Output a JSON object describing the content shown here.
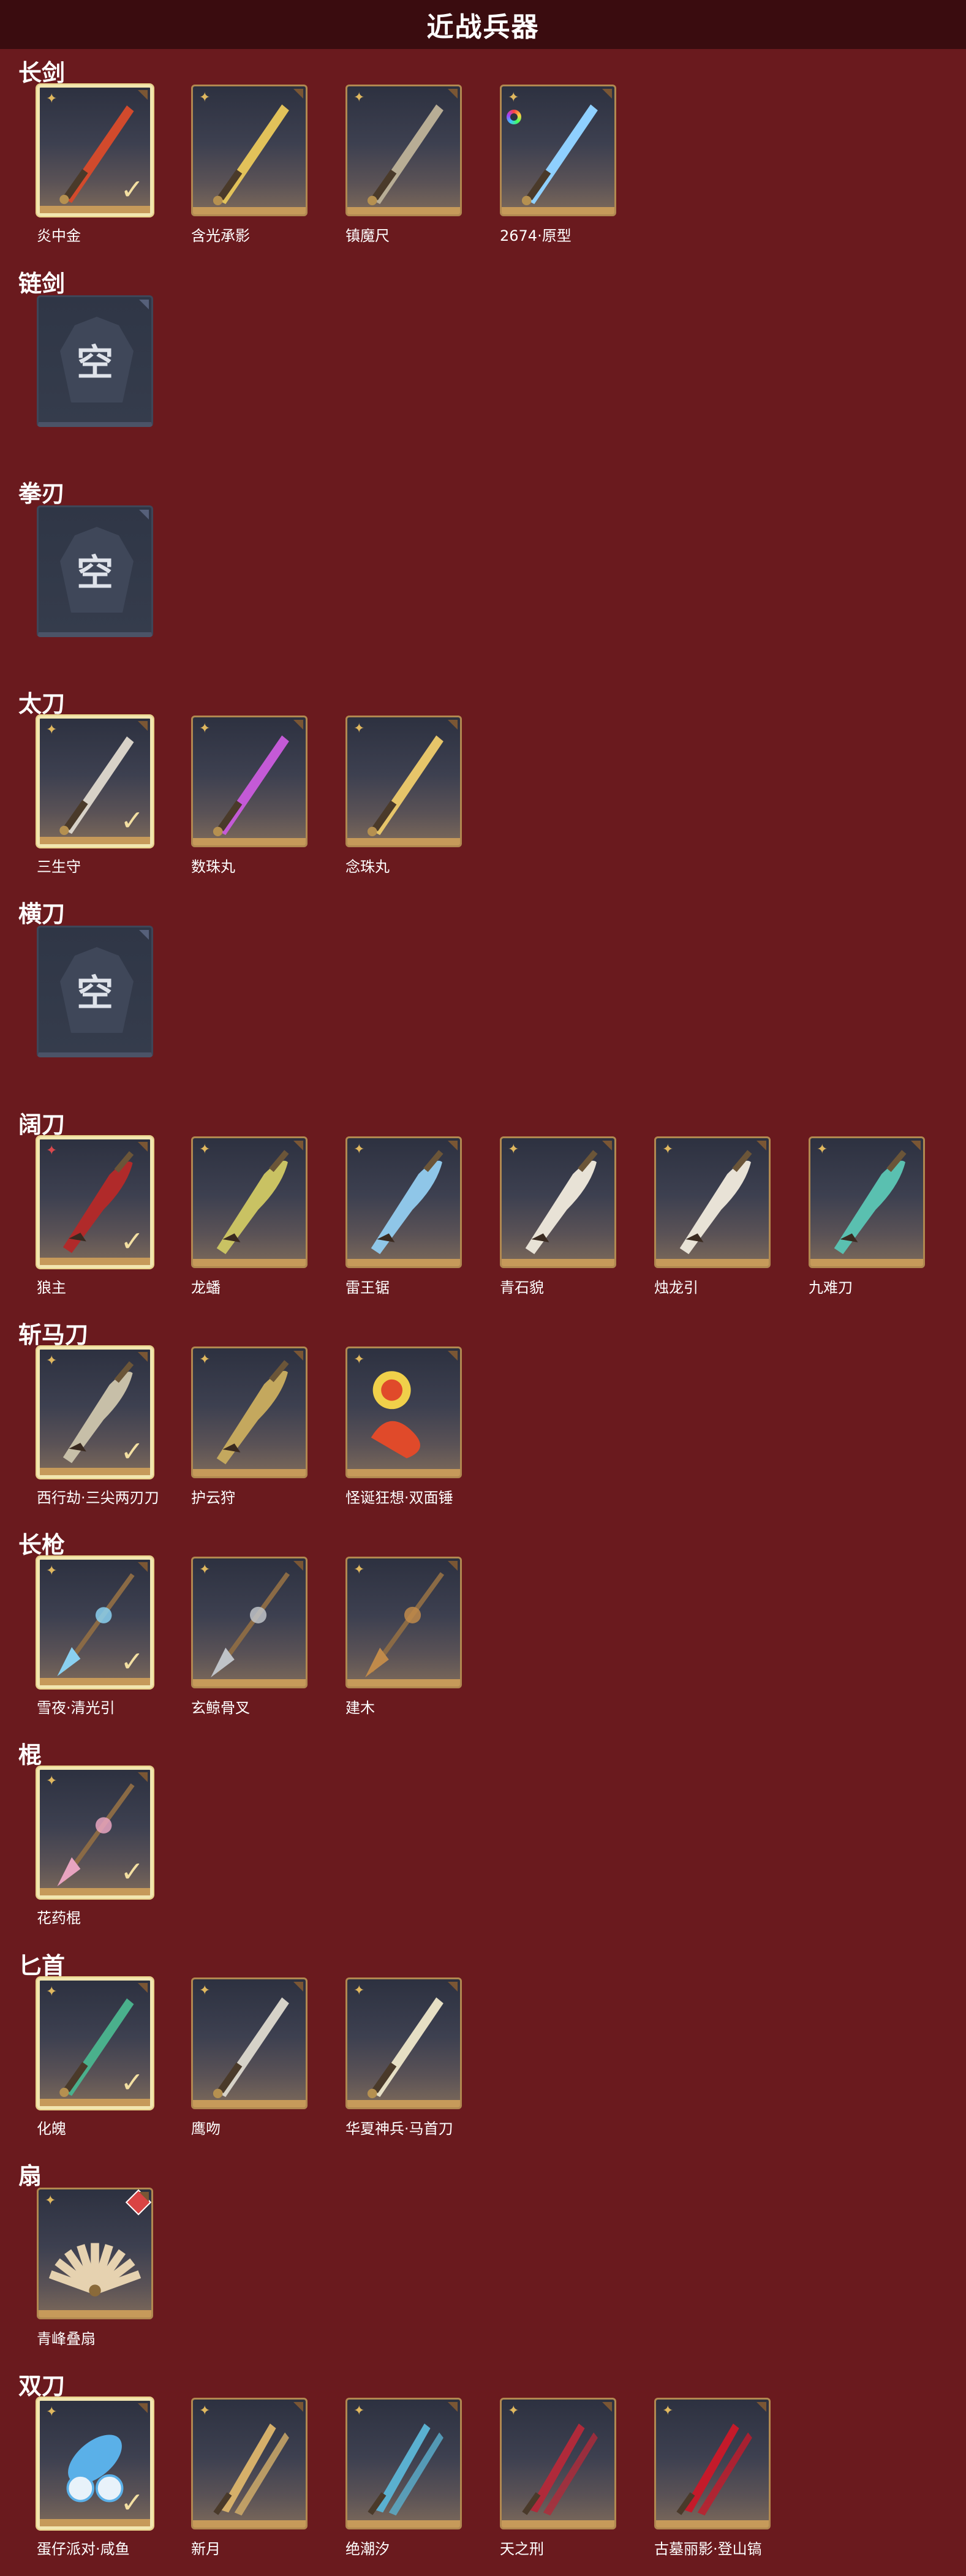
{
  "title": "近战兵器",
  "colors": {
    "background": "#6a1a1e",
    "topbar": "#3a0c0f",
    "card_border": "#b18850",
    "selected_border": "#f2e6b0"
  },
  "sections": [
    {
      "title": "长剑",
      "items": [
        {
          "name": "炎中金",
          "selected": true,
          "icon": "sword-icon",
          "tint": "#d24a2c"
        },
        {
          "name": "含光承影",
          "selected": false,
          "icon": "sword-icon",
          "tint": "#e2c25a"
        },
        {
          "name": "镇魔尺",
          "selected": false,
          "icon": "sword-icon",
          "tint": "#b8ad95"
        },
        {
          "name": "2674·原型",
          "selected": false,
          "icon": "sword-icon",
          "tint": "#8fd0ff",
          "color_ring": true
        }
      ]
    },
    {
      "title": "链剑",
      "items": [
        {
          "empty": true,
          "empty_text": "空"
        }
      ]
    },
    {
      "title": "拳刃",
      "items": [
        {
          "empty": true,
          "empty_text": "空"
        }
      ]
    },
    {
      "title": "太刀",
      "items": [
        {
          "name": "三生守",
          "selected": true,
          "icon": "katana-icon",
          "tint": "#d8d2c8"
        },
        {
          "name": "数珠丸",
          "selected": false,
          "icon": "katana-icon",
          "tint": "#c45ad6"
        },
        {
          "name": "念珠丸",
          "selected": false,
          "icon": "katana-icon",
          "tint": "#e6c56a"
        }
      ]
    },
    {
      "title": "横刀",
      "items": [
        {
          "empty": true,
          "empty_text": "空"
        }
      ]
    },
    {
      "title": "阔刀",
      "items": [
        {
          "name": "狼主",
          "selected": true,
          "icon": "broadblade-icon",
          "tint": "#b02a2a",
          "rarity_red": true
        },
        {
          "name": "龙蟠",
          "selected": false,
          "icon": "broadblade-icon",
          "tint": "#c9c263"
        },
        {
          "name": "雷王锯",
          "selected": false,
          "icon": "broadblade-icon",
          "tint": "#8fc6e8"
        },
        {
          "name": "青石貌",
          "selected": false,
          "icon": "broadblade-icon",
          "tint": "#e8e2d6"
        },
        {
          "name": "烛龙引",
          "selected": false,
          "icon": "broadblade-icon",
          "tint": "#e8e2d6"
        },
        {
          "name": "九难刀",
          "selected": false,
          "icon": "broadblade-icon",
          "tint": "#5ac0b0"
        }
      ]
    },
    {
      "title": "斩马刀",
      "items": [
        {
          "name": "西行劫·三尖两刃刀",
          "selected": true,
          "icon": "glaive-icon",
          "tint": "#c7bfa8"
        },
        {
          "name": "护云狩",
          "selected": false,
          "icon": "glaive-icon",
          "tint": "#c4a85e"
        },
        {
          "name": "怪诞狂想·双面锤",
          "selected": false,
          "icon": "hammer-icon",
          "tint": "#e04a2a"
        }
      ]
    },
    {
      "title": "长枪",
      "items": [
        {
          "name": "雪夜·清光引",
          "selected": true,
          "icon": "spear-icon",
          "tint": "#8ad0f0"
        },
        {
          "name": "玄鲸骨叉",
          "selected": false,
          "icon": "trident-icon",
          "tint": "#bfc3c8"
        },
        {
          "name": "建木",
          "selected": false,
          "icon": "spear-icon",
          "tint": "#c08a4a"
        }
      ]
    },
    {
      "title": "棍",
      "items": [
        {
          "name": "花药棍",
          "selected": true,
          "icon": "staff-icon",
          "tint": "#e8a4c0"
        }
      ]
    },
    {
      "title": "匕首",
      "items": [
        {
          "name": "化魄",
          "selected": true,
          "icon": "dagger-icon",
          "tint": "#4ab08c"
        },
        {
          "name": "鹰吻",
          "selected": false,
          "icon": "dagger-icon",
          "tint": "#d6d2c8"
        },
        {
          "name": "华夏神兵·马首刀",
          "selected": false,
          "icon": "dagger-icon",
          "tint": "#e6dfc4"
        }
      ]
    },
    {
      "title": "扇",
      "items": [
        {
          "name": "青峰叠扇",
          "selected": false,
          "icon": "fan-icon",
          "tint": "#e6d2b0",
          "badge": true
        }
      ]
    },
    {
      "title": "双刀",
      "items": [
        {
          "name": "蛋仔派对·咸鱼",
          "selected": true,
          "icon": "fish-icon",
          "tint": "#5ab0e8"
        },
        {
          "name": "新月",
          "selected": false,
          "icon": "dual-blade-icon",
          "tint": "#d6b06a"
        },
        {
          "name": "绝潮汐",
          "selected": false,
          "icon": "dual-blade-icon",
          "tint": "#5ab0d0"
        },
        {
          "name": "天之刑",
          "selected": false,
          "icon": "dual-blade-icon",
          "tint": "#b02a3a"
        },
        {
          "name": "古墓丽影·登山镐",
          "selected": false,
          "icon": "dual-blade-icon",
          "tint": "#c41a2a"
        }
      ]
    }
  ]
}
